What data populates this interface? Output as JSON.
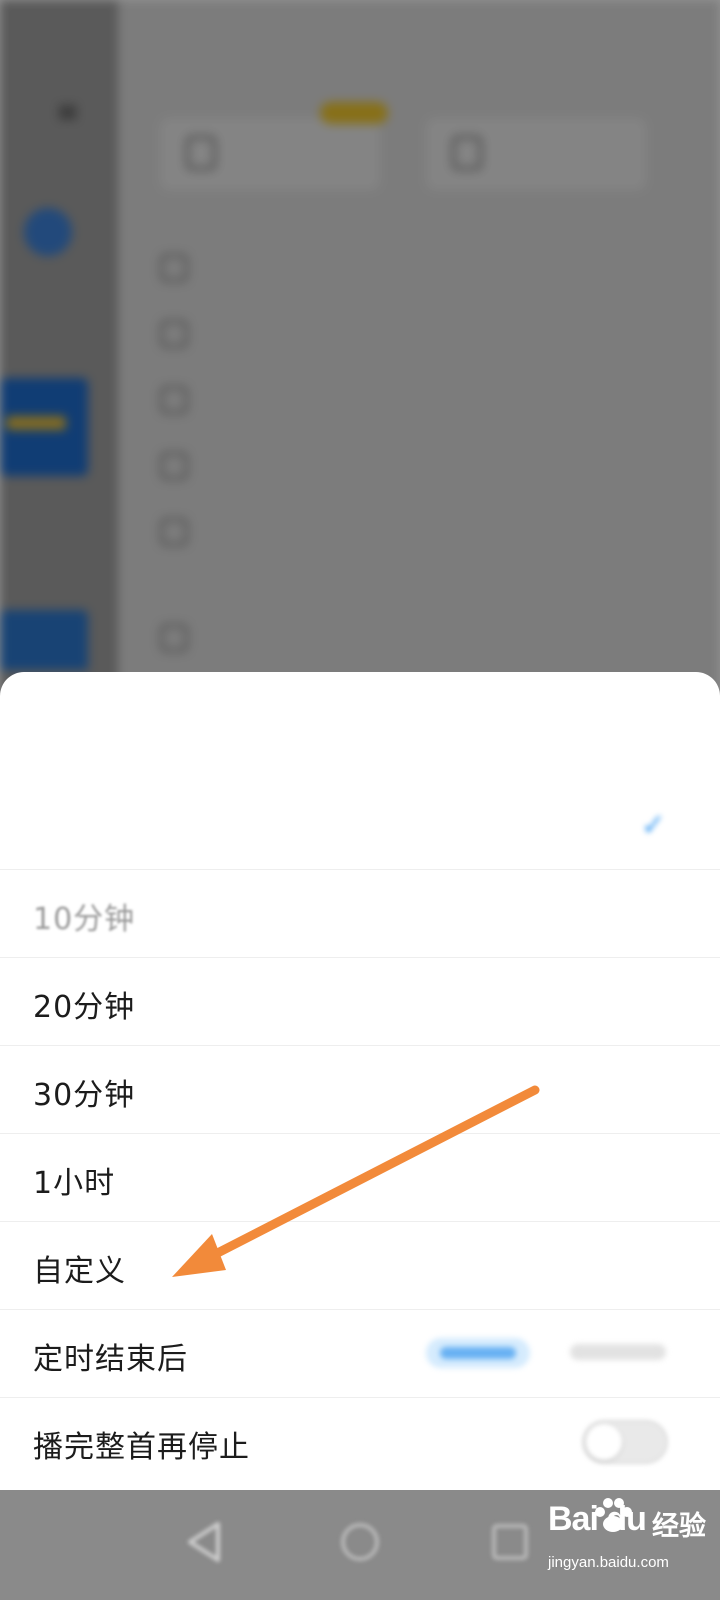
{
  "status_bar": {
    "carrier": "",
    "system_info": ""
  },
  "sheet": {
    "title": "",
    "subtitle": "",
    "options": [
      {
        "id": "off",
        "label": "",
        "selected": true
      },
      {
        "id": "10min",
        "label": "10分钟"
      },
      {
        "id": "20min",
        "label": "20分钟"
      },
      {
        "id": "30min",
        "label": "30分钟"
      },
      {
        "id": "1h",
        "label": "1小时"
      },
      {
        "id": "custom",
        "label": "自定义"
      }
    ],
    "after_timer": {
      "label": "定时结束后"
    },
    "finish_song": {
      "label": "播完整首再停止",
      "enabled": false
    }
  },
  "watermark": {
    "brand": "Bai du",
    "product": "经验",
    "url": "jingyan.baidu.com"
  },
  "colors": {
    "accent_blue": "#3a9bf2",
    "annotation_arrow": "#f28a3a",
    "sheet_background": "#ffffff",
    "nav_bar": "#8a8a8a"
  },
  "icons": {
    "check": "check-icon",
    "back": "nav-back-icon",
    "home": "nav-home-icon",
    "recent": "nav-recent-icon",
    "paw": "baidu-paw-icon"
  }
}
